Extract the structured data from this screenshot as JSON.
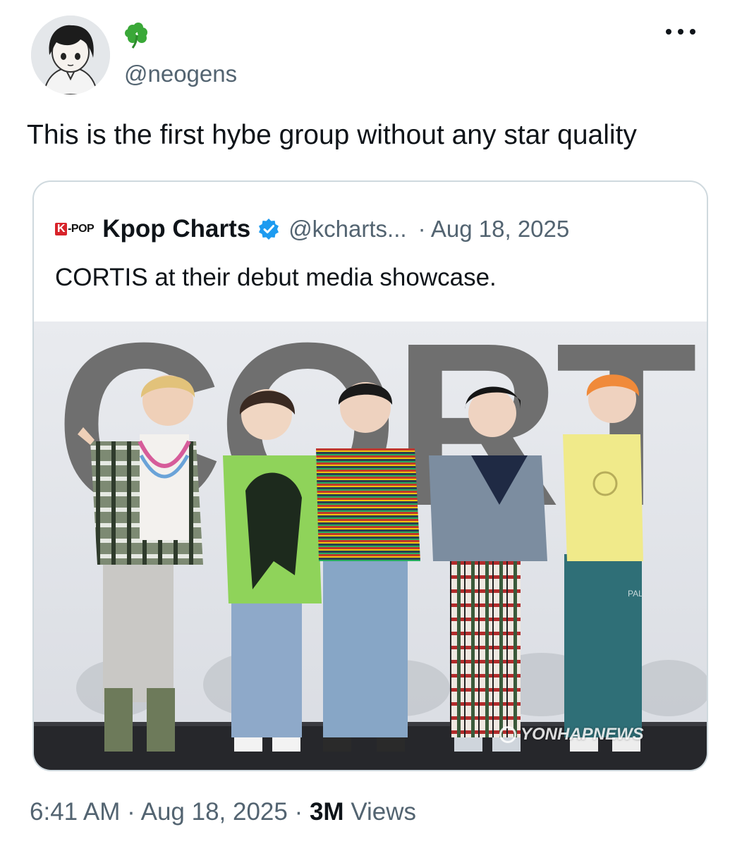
{
  "tweet": {
    "display_name_emoji": "🍀",
    "handle": "@neogens",
    "text": "This is the first hybe group without any star quality",
    "meta": {
      "time": "6:41 AM",
      "sep1": " · ",
      "date": "Aug 18, 2025",
      "sep2": " · ",
      "views_count": "3M",
      "views_label": " Views"
    }
  },
  "quote": {
    "logo_k": "K",
    "logo_rest": "-POP",
    "name": "Kpop Charts",
    "handle": "@kcharts...",
    "date": "· Aug 18, 2025",
    "text": "CORTIS at their debut media showcase.",
    "photo": {
      "backdrop_text": "CORTI",
      "watermark": "YONHAPNEWS",
      "shirt_text": "PAL"
    }
  },
  "icons": {
    "verified": "verified-badge-icon",
    "more": "more-options-icon",
    "clover": "four-leaf-clover-icon"
  },
  "colors": {
    "text_primary": "#0f1419",
    "text_secondary": "#536471",
    "verified_blue": "#1d9bf0",
    "card_border": "#cfd9de"
  }
}
